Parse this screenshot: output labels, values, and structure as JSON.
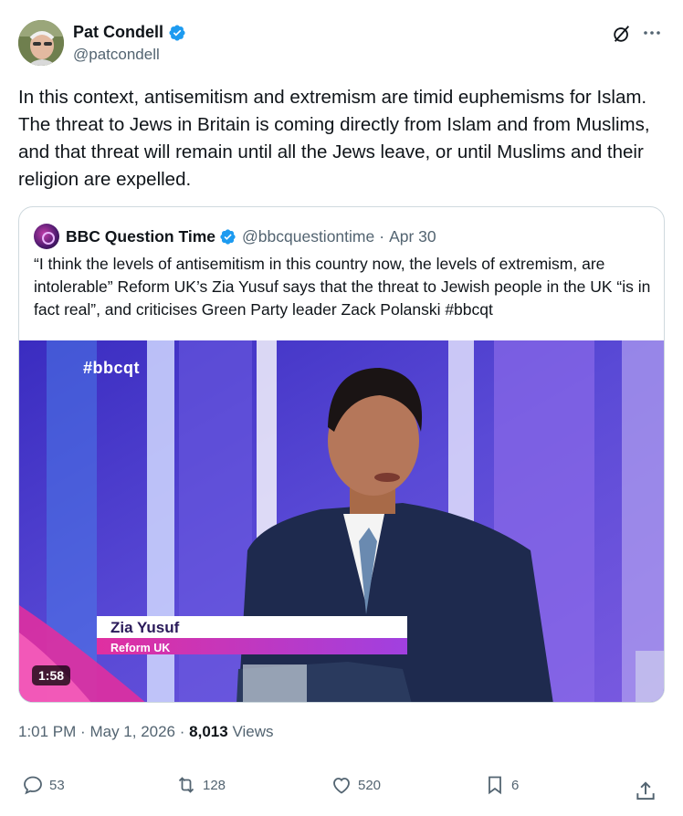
{
  "author": {
    "display_name": "Pat Condell",
    "handle": "@patcondell",
    "icons": {
      "verified": "verified-badge-icon",
      "grok": "grok-icon",
      "more": "more-options-icon"
    }
  },
  "tweet": {
    "text": "In this context, antisemitism and extremism are timid euphemisms for Islam. The threat to Jews in Britain is coming directly from Islam and from Muslims, and that threat will remain until all the Jews leave, or until Muslims and their religion are expelled."
  },
  "quote": {
    "display_name": "BBC Question Time",
    "handle": "@bbcquestiontime",
    "separator": "·",
    "date": "Apr 30",
    "text": "“I think the levels of antisemitism in this country now, the levels of extremism, are intolerable” Reform UK’s Zia Yusuf says that the threat to Jewish people in the UK “is in fact real”, and criticises Green Party leader Zack Polanski #bbcqt",
    "video": {
      "hashtag": "#bbcqt",
      "caption_name": "Zia Yusuf",
      "caption_role": "Reform UK",
      "duration": "1:58"
    }
  },
  "meta": {
    "time": "1:01 PM",
    "separator": "·",
    "date": "May 1, 2026",
    "views_count": "8,013",
    "views_label": "Views"
  },
  "actions": {
    "replies": "53",
    "reposts": "128",
    "likes": "520",
    "bookmarks": "6"
  },
  "colors": {
    "verified_blue": "#1d9bf0",
    "text_primary": "#0f1419",
    "text_secondary": "#536471",
    "border": "#cfd9de"
  }
}
